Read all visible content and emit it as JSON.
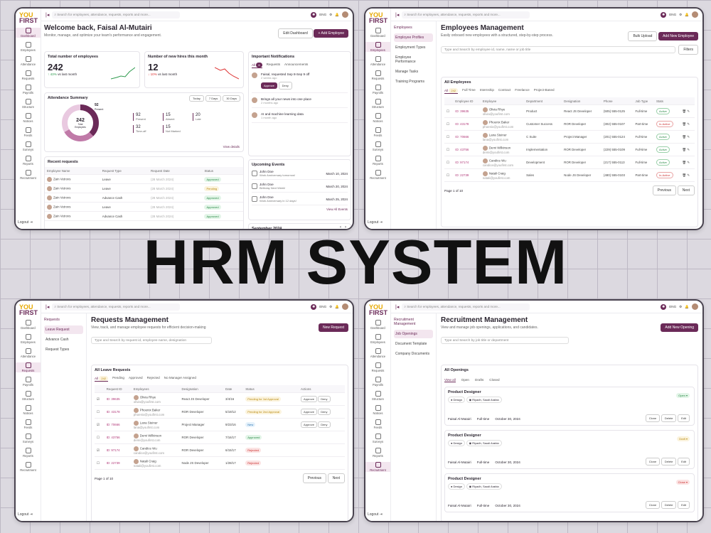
{
  "headline": "HRM SYSTEM",
  "logo": {
    "a": "YOU",
    "b": "FIRST"
  },
  "search_placeholder": "Search for employees, attendance, requests, reports and more...",
  "lang": "ENG",
  "rail": {
    "items": [
      "Dashboard",
      "Employees",
      "Attendance",
      "Requests",
      "Payrolls",
      "Structure",
      "Notices",
      "Feeds",
      "Surveys",
      "Reports",
      "Recruitment"
    ],
    "logout": "Logout"
  },
  "dash": {
    "title": "Welcome back, Faisal Al-Mutairi",
    "subtitle": "Monitor, manage, and optimize your team's performance and engagement.",
    "edit": "Edit Dashboard",
    "add": "+ Add Employee",
    "total_label": "Total number of employees",
    "total": "242",
    "total_delta": "43%",
    "total_vs": "vs last month",
    "hires_label": "Number of new hires this month",
    "hires": "12",
    "hires_delta": "10%",
    "hires_vs": "vs last month",
    "att_title": "Attendance Summary",
    "periods": [
      "Today",
      "7 Days",
      "30 Days"
    ],
    "donut_val": "242",
    "donut_sub": "Total Employees",
    "donut_badge": "92",
    "donut_badge_lbl": "Present",
    "att": [
      {
        "v": "92",
        "l": "Present"
      },
      {
        "v": "15",
        "l": "Absent"
      },
      {
        "v": "20",
        "l": "Late"
      },
      {
        "v": "32",
        "l": "Time-off"
      },
      {
        "v": "15",
        "l": "Not Marked"
      }
    ],
    "details": "View details",
    "recent_title": "Recent requests",
    "recent_cols": [
      "Employee Name",
      "Request Type",
      "Request Date",
      "Status"
    ],
    "recent": [
      {
        "n": "Zain Vetrovs",
        "t": "Leave",
        "d": "(28 March 2024)",
        "s": "Approved"
      },
      {
        "n": "Zain Vetrovs",
        "t": "Leave",
        "d": "(28 March 2024)",
        "s": "Pending"
      },
      {
        "n": "Zain Vetrovs",
        "t": "Advance Cash",
        "d": "(28 March 2024)",
        "s": "Approved"
      },
      {
        "n": "Zain Vetrovs",
        "t": "Leave",
        "d": "(28 March 2024)",
        "s": "Approved"
      },
      {
        "n": "Zain Vetrovs",
        "t": "Advance Cash",
        "d": "(28 March 2024)",
        "s": "Approved"
      }
    ],
    "notif_title": "Important Notifications",
    "notif_tabs": [
      "All",
      "Requests",
      "Announcements"
    ],
    "notif_count": "6",
    "notifs": [
      {
        "t": "Faisal, requested Sep 8-Sep 9 off",
        "w": "2 weeks ago",
        "actions": true
      },
      {
        "t": "Brings all your news into one place",
        "w": "2 months ago"
      },
      {
        "t": "AI and machine learning data",
        "w": "1 month ago"
      }
    ],
    "approve": "Approve",
    "deny": "Deny",
    "events_title": "Upcoming Events",
    "events": [
      {
        "n": "John Doe",
        "e": "Work Anniversary tomorrow!",
        "d": "March 10, 2024"
      },
      {
        "n": "John Doe",
        "e": "Birthday Next Week!",
        "d": "March 20, 2024"
      },
      {
        "n": "John Doe",
        "e": "Work Anniversary in 12 days!",
        "d": "March 25, 2024"
      }
    ],
    "all_events": "View All Events",
    "calendar": "September 2024"
  },
  "emp": {
    "subnav_title": "Employees",
    "subnav": [
      "Employee Profiles",
      "Employment Types",
      "Employee Performance",
      "Manage Tasks",
      "Training Programs"
    ],
    "title": "Employees Management",
    "subtitle": "Easily onboard new employees with a structured, step-by-step process.",
    "bulk": "Bulk Upload",
    "add": "Add New Employee",
    "search": "Type and Search by employee id, name, name or job title",
    "filters": "Filters",
    "all": "All Employees",
    "tabs": [
      "All",
      "Full Time",
      "Internship",
      "Contract",
      "Freelance",
      "Project-Based"
    ],
    "count": "242",
    "cols": [
      "Employee ID",
      "Employee",
      "Department",
      "Designation",
      "Phone",
      "Job Type",
      "Stats"
    ],
    "rows": [
      {
        "id": "ID: 39635",
        "n": "Olivia Rhye",
        "e": "olivia@youfirst.com",
        "dp": "Product",
        "ds": "React JS Developer",
        "p": "(505) 555-0125",
        "j": "Full-time",
        "s": "Active"
      },
      {
        "id": "ID: 43178",
        "n": "Phoenix Baker",
        "e": "phoenix@youfirst.com",
        "dp": "Customer Success",
        "ds": "ROR Developer",
        "p": "(302) 555-0107",
        "j": "Part-time",
        "s": "In-Active"
      },
      {
        "id": "ID: 70666",
        "n": "Lana Steiner",
        "e": "lana@youfirst.com",
        "dp": "C Suite",
        "ds": "Project Manager",
        "p": "(201) 555-0124",
        "j": "Full-time",
        "s": "Active"
      },
      {
        "id": "ID: 43756",
        "n": "Demi Wilkinson",
        "e": "demi@youfirst.com",
        "dp": "Implementation",
        "ds": "ROR Developer",
        "p": "(229) 555-0109",
        "j": "Full-time",
        "s": "Active"
      },
      {
        "id": "ID: 97174",
        "n": "Candice Wu",
        "e": "candice@youfirst.com",
        "dp": "Development",
        "ds": "ROR Developer",
        "p": "(217) 555-0113",
        "j": "Full-time",
        "s": "Active"
      },
      {
        "id": "ID: 22739",
        "n": "Natali Craig",
        "e": "natali@youfirst.com",
        "dp": "Sales",
        "ds": "Node JS Developer",
        "p": "(480) 555-0103",
        "j": "Part-time",
        "s": "In-Active"
      }
    ],
    "page": "Page 1 of 10",
    "prev": "Previous",
    "next": "Next"
  },
  "req": {
    "subnav_title": "Requests",
    "subnav": [
      "Leave Request",
      "Advance Cash",
      "Request Types"
    ],
    "title": "Requests Management",
    "subtitle": "View, track, and manage employee requests for efficient decision-making",
    "new": "New Request",
    "search": "Type and Search by request id, employee name, designation",
    "all": "All Leave Requests",
    "tabs": [
      "All",
      "Pending",
      "Approved",
      "Rejected",
      "No Manager Assigned"
    ],
    "count": "242",
    "cols": [
      "Request ID",
      "Employees",
      "Designation",
      "Date",
      "Status",
      "Actions"
    ],
    "rows": [
      {
        "id": "ID: 39635",
        "n": "Olivia Rhye",
        "e": "olivia@youfirst.com",
        "d": "React JS Developer",
        "dt": "3/4/16",
        "s": "Pending for 1st Approval",
        "k": "pend",
        "act": true
      },
      {
        "id": "ID: 43178",
        "n": "Phoenix Baker",
        "e": "phoenix@youfirst.com",
        "d": "ROR Developer",
        "dt": "5/19/12",
        "s": "Pending for 2nd Approval",
        "k": "pend",
        "act": true
      },
      {
        "id": "ID: 70666",
        "n": "Lana Steiner",
        "e": "lana@youfirst.com",
        "d": "Project Manager",
        "dt": "9/23/16",
        "s": "New",
        "k": "new",
        "act": true
      },
      {
        "id": "ID: 43756",
        "n": "Demi Wilkinson",
        "e": "demi@youfirst.com",
        "d": "ROR Developer",
        "dt": "7/16/17",
        "s": "Approved",
        "k": "ok"
      },
      {
        "id": "ID: 97174",
        "n": "Candice Wu",
        "e": "candice@youfirst.com",
        "d": "ROR Developer",
        "dt": "6/15/17",
        "s": "Rejected",
        "k": "rej"
      },
      {
        "id": "ID: 22739",
        "n": "Natali Craig",
        "e": "natali@youfirst.com",
        "d": "Node JS Developer",
        "dt": "1/28/17",
        "s": "Rejected",
        "k": "rej"
      }
    ],
    "approve": "Approve",
    "deny": "Deny",
    "page": "Page 1 of 10",
    "prev": "Previous",
    "next": "Next"
  },
  "rec": {
    "subnav_title": "Recruitment Management",
    "subnav": [
      "Job Openings",
      "Document Template",
      "Company Documents"
    ],
    "title": "Recruitment Management",
    "subtitle": "View and manage job openings, applications, and candidates.",
    "new": "Add New Opening",
    "search": "Type and Search by job title or department",
    "all": "All Openings",
    "tabs": [
      "View all",
      "Open",
      "Drafts",
      "Closed"
    ],
    "jobs": [
      {
        "t": "Product Designer",
        "dep": "Design",
        "loc": "Riyadh, Saudi Arabia",
        "s": "Open",
        "o": "Faisal Al-Mutairi",
        "j": "Full-time",
        "d": "October 30, 2024"
      },
      {
        "t": "Product Designer",
        "dep": "Design",
        "loc": "Riyadh, Saudi Arabia",
        "s": "Draft",
        "o": "Faisal Al-Mutairi",
        "j": "Full-time",
        "d": "October 30, 2024"
      },
      {
        "t": "Product Designer",
        "dep": "Design",
        "loc": "Riyadh, Saudi Arabia",
        "s": "Close",
        "o": "Faisal Al-Mutairi",
        "j": "Full-time",
        "d": "October 30, 2024"
      }
    ],
    "clone": "Clone",
    "delete": "Delete",
    "edit": "Edit"
  }
}
